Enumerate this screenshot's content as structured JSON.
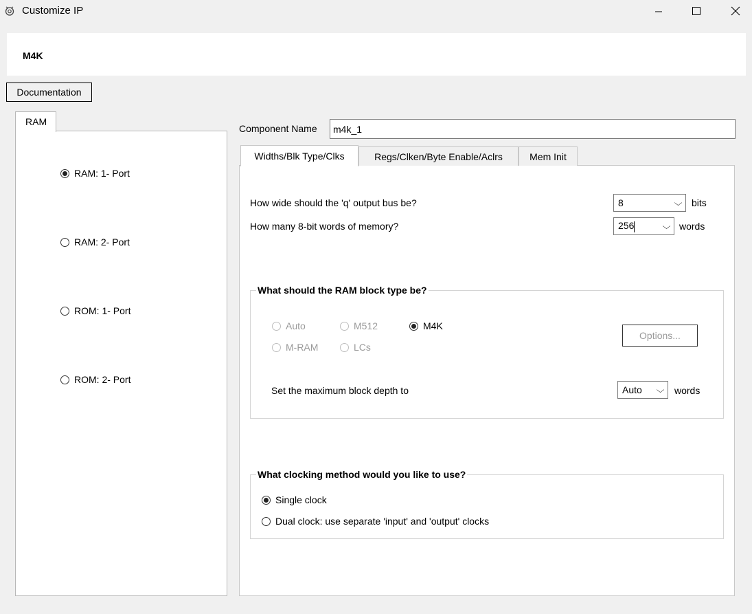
{
  "window": {
    "title": "Customize IP",
    "controls": [
      "minimize-icon",
      "maximize-icon",
      "close-icon"
    ]
  },
  "header": {
    "title": "M4K"
  },
  "documentation_button": "Documentation",
  "left_panel": {
    "tab": "RAM",
    "options": [
      {
        "label": "RAM:  1- Port",
        "checked": true
      },
      {
        "label": "RAM:  2- Port",
        "checked": false
      },
      {
        "label": "ROM:  1- Port",
        "checked": false
      },
      {
        "label": "ROM:  2- Port",
        "checked": false
      }
    ]
  },
  "component": {
    "label": "Component Name",
    "value": "m4k_1"
  },
  "tabs": [
    "Widths/Blk Type/Clks",
    "Regs/Clken/Byte Enable/Aclrs",
    "Mem Init"
  ],
  "active_tab": 0,
  "widths": {
    "q_question": "How wide should the 'q' output bus be?",
    "q_value": "8",
    "q_unit": "bits",
    "words_question": "How many 8-bit words of memory?",
    "words_value": "256",
    "words_unit": "words"
  },
  "block_type": {
    "title": "What should the RAM block type be?",
    "options": [
      {
        "label": "Auto",
        "checked": false,
        "enabled": false
      },
      {
        "label": "M512",
        "checked": false,
        "enabled": false
      },
      {
        "label": "M4K",
        "checked": true,
        "enabled": true
      },
      {
        "label": "M-RAM",
        "checked": false,
        "enabled": false
      },
      {
        "label": "LCs",
        "checked": false,
        "enabled": false
      }
    ],
    "options_button": "Options...",
    "depth_label": "Set the maximum block depth to",
    "depth_value": "Auto",
    "depth_unit": "words"
  },
  "clocking": {
    "title": "What clocking method would you like to use?",
    "options": [
      {
        "label": "Single clock",
        "checked": true
      },
      {
        "label": "Dual clock: use separate 'input' and 'output' clocks",
        "checked": false
      }
    ]
  }
}
